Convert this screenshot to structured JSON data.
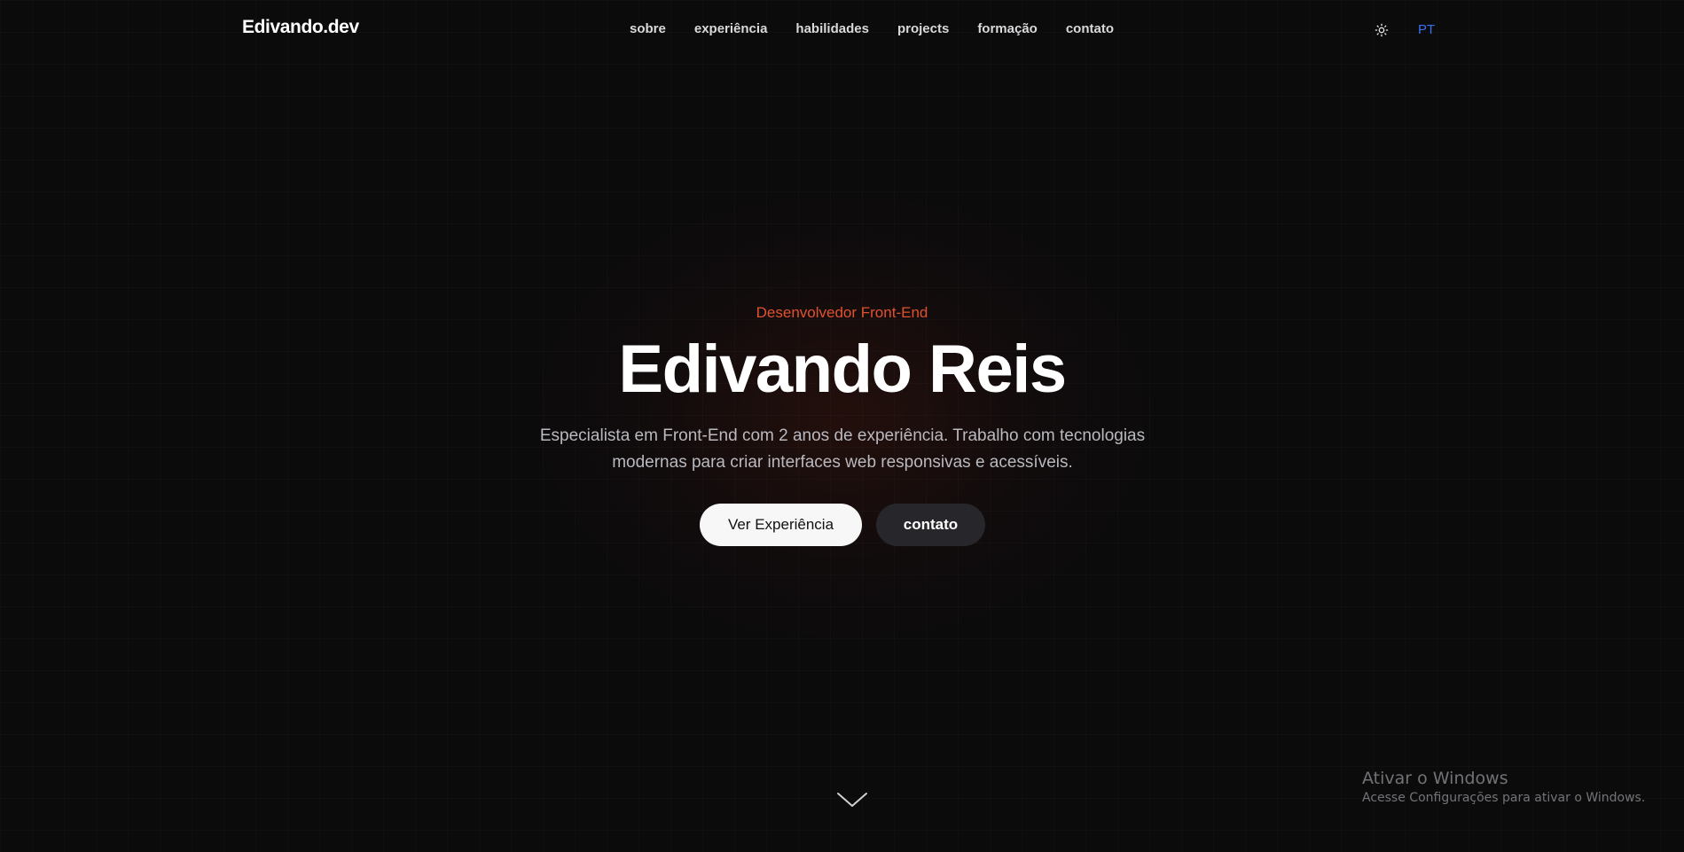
{
  "header": {
    "logo": "Edivando.dev",
    "nav": [
      {
        "label": "sobre"
      },
      {
        "label": "experiência"
      },
      {
        "label": "habilidades"
      },
      {
        "label": "projects"
      },
      {
        "label": "formação"
      },
      {
        "label": "contato"
      }
    ],
    "theme_icon": "sun-icon",
    "language": "PT"
  },
  "hero": {
    "role": "Desenvolvedor Front-End",
    "name": "Edivando Reis",
    "description": "Especialista em Front-End com 2 anos de experiência. Trabalho com tecnologias modernas para criar interfaces web responsivas e acessíveis.",
    "primary_button": "Ver Experiência",
    "secondary_button": "contato",
    "scroll_icon": "chevron-down-icon"
  },
  "watermark": {
    "title": "Ativar o Windows",
    "subtitle": "Acesse Configurações para ativar o Windows."
  },
  "colors": {
    "background": "#0b0b0c",
    "accent": "#e0522f",
    "language_link": "#3b6ef0",
    "primary_button_bg": "#f7f7f7",
    "secondary_button_bg": "#27272b"
  }
}
